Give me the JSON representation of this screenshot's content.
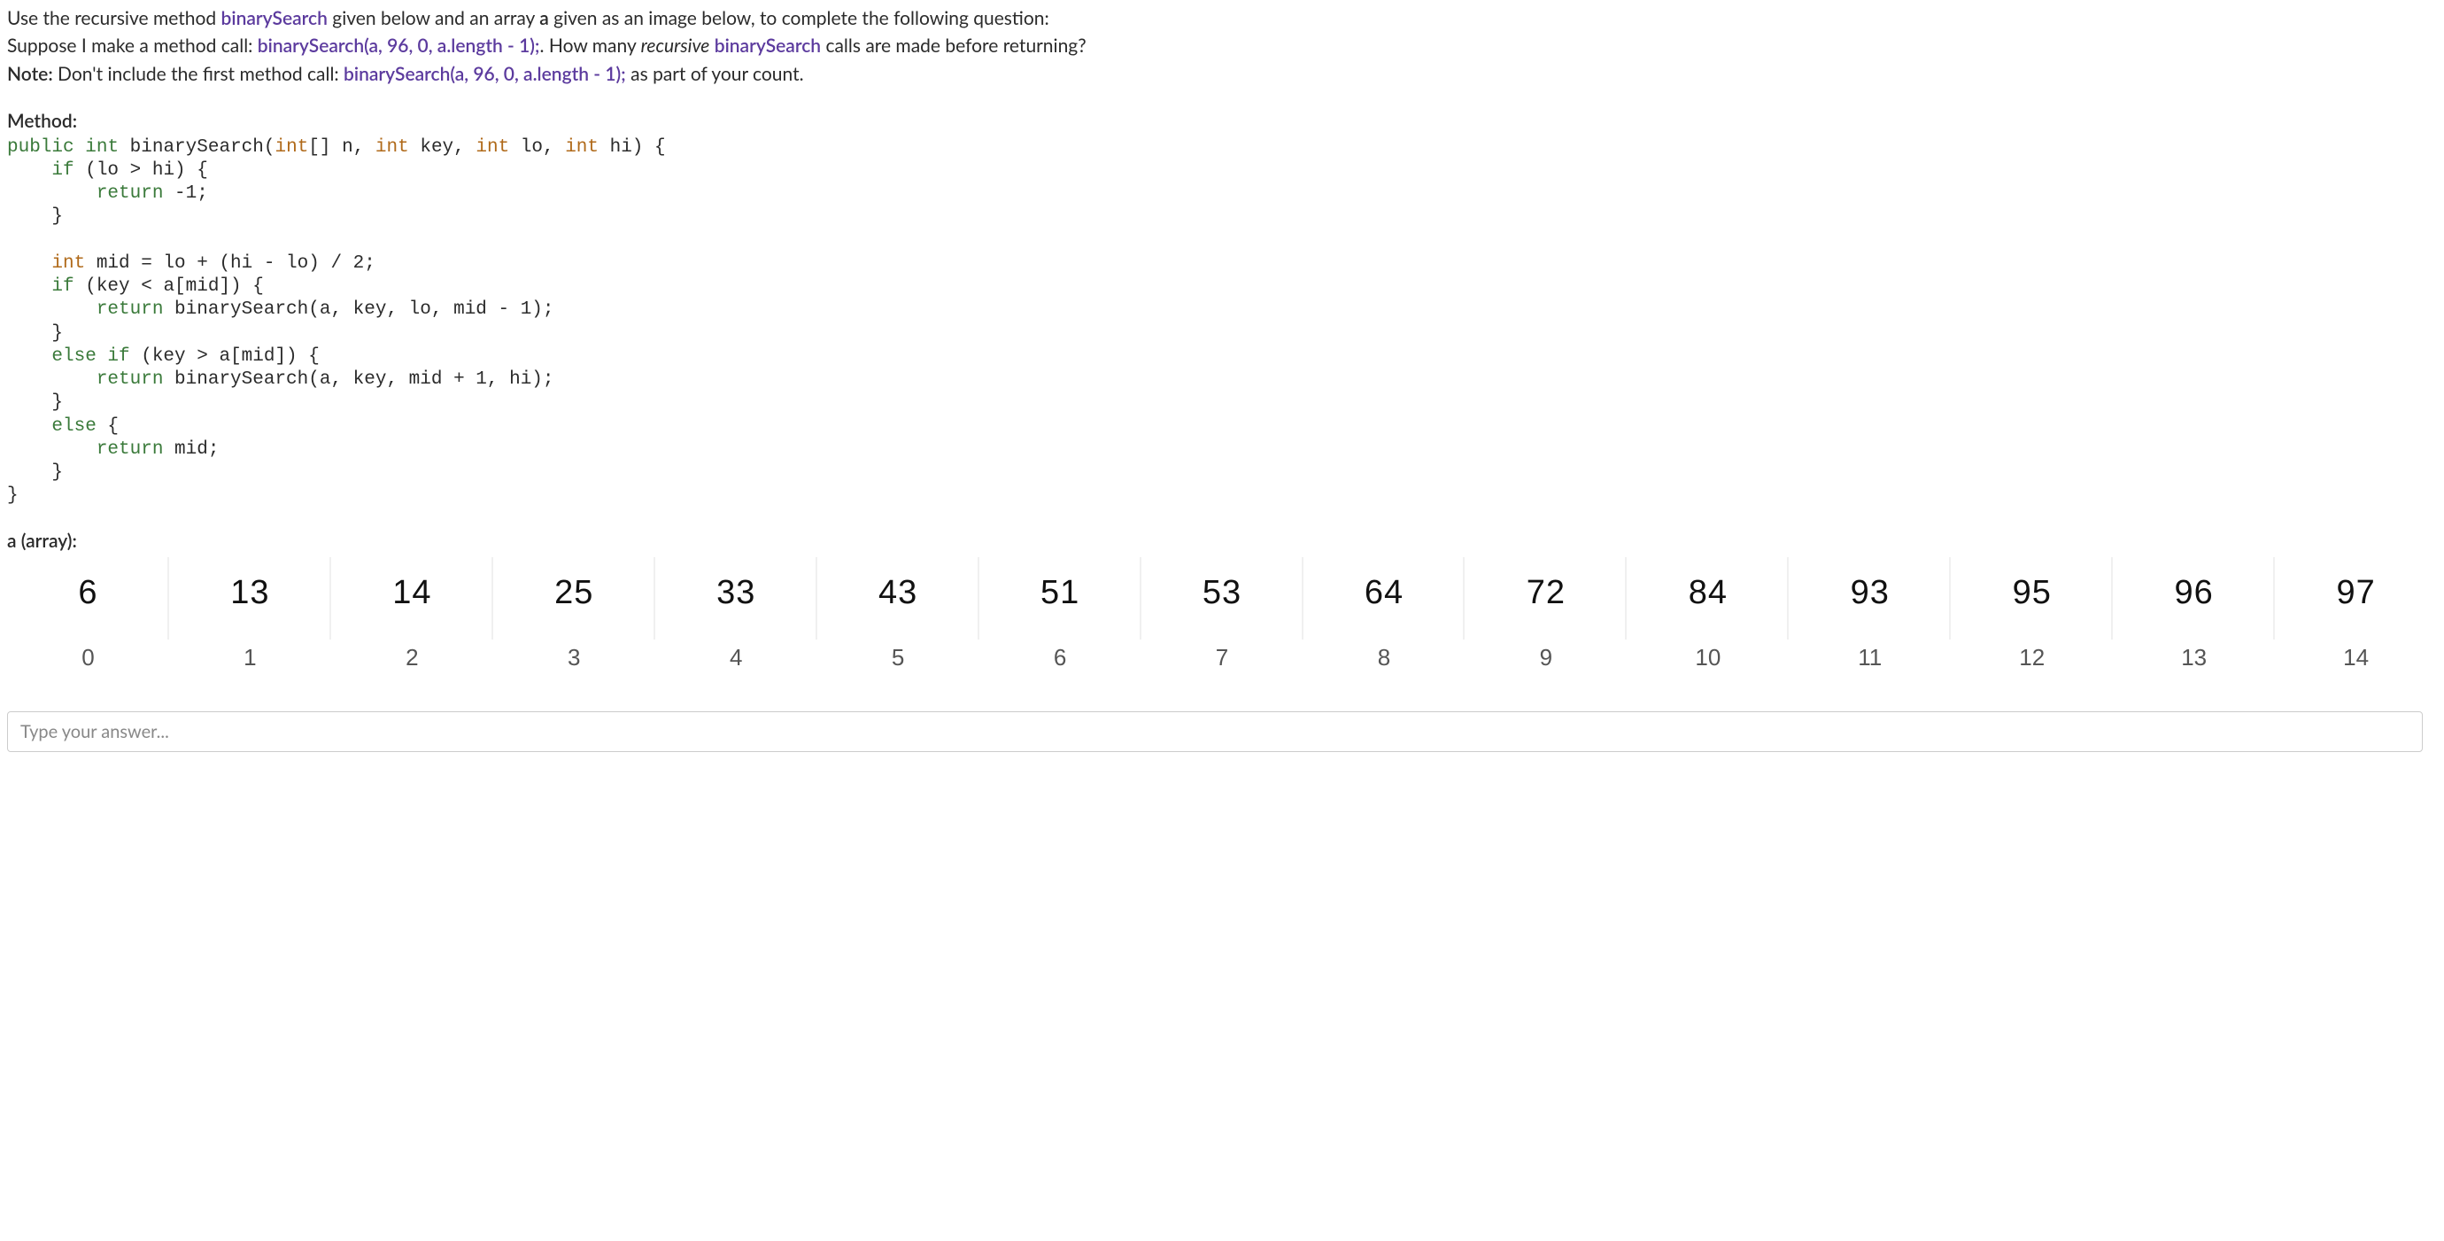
{
  "question": {
    "line1_pre": "Use the recursive method ",
    "line1_method": "binarySearch",
    "line1_mid1": " given below and an array ",
    "line1_a": "a",
    "line1_post": " given as an image below, to complete the following question:",
    "line2_pre": "Suppose I make a method call: ",
    "line2_call": "binarySearch(a, 96, 0, a.length - 1);",
    "line2_mid": ". How many ",
    "line2_recursive": "recursive",
    "line2_space": " ",
    "line2_method": "binarySearch",
    "line2_post": " calls are made before returning?",
    "note_label": "Note:",
    "note_mid": " Don't include the first method call: ",
    "note_call": "binarySearch(a, 96, 0, a.length - 1);",
    "note_post": " as part of your count."
  },
  "method_label": "Method:",
  "code": {
    "l1_public": "public",
    "l1_sp1": " ",
    "l1_int": "int",
    "l1_name": " binarySearch(",
    "l1_t1": "int",
    "l1_p1": "[] n, ",
    "l1_t2": "int",
    "l1_p2": " key, ",
    "l1_t3": "int",
    "l1_p3": " lo, ",
    "l1_t4": "int",
    "l1_p4": " hi) {",
    "l2_if": "    if",
    "l2_rest": " (lo > hi) {",
    "l3_ret": "        return",
    "l3_rest": " -1;",
    "l4": "    }",
    "blank": "",
    "l6_int": "    int",
    "l6_rest": " mid = lo + (hi - lo) / 2;",
    "l7_if": "    if",
    "l7_rest": " (key < a[mid]) {",
    "l8_ret": "        return",
    "l8_rest": " binarySearch(a, key, lo, mid - 1);",
    "l9": "    }",
    "l10_else": "    else if",
    "l10_rest": " (key > a[mid]) {",
    "l11_ret": "        return",
    "l11_rest": " binarySearch(a, key, mid + 1, hi);",
    "l12": "    }",
    "l13_else": "    else",
    "l13_rest": " {",
    "l14_ret": "        return",
    "l14_rest": " mid;",
    "l15": "    }",
    "l16": "}"
  },
  "array_label": "a (array):",
  "array": {
    "values": [
      "6",
      "13",
      "14",
      "25",
      "33",
      "43",
      "51",
      "53",
      "64",
      "72",
      "84",
      "93",
      "95",
      "96",
      "97"
    ],
    "indices": [
      "0",
      "1",
      "2",
      "3",
      "4",
      "5",
      "6",
      "7",
      "8",
      "9",
      "10",
      "11",
      "12",
      "13",
      "14"
    ]
  },
  "answer_placeholder": "Type your answer..."
}
